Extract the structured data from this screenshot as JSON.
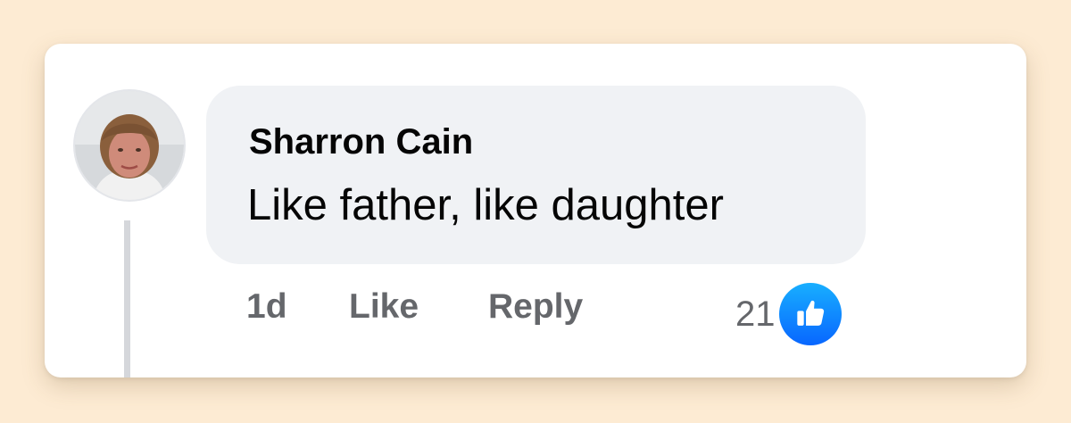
{
  "comment": {
    "author": "Sharron Cain",
    "text": "Like father, like daughter",
    "timestamp": "1d",
    "like_label": "Like",
    "reply_label": "Reply",
    "reaction_count": "21",
    "reaction_type": "thumbs-up-icon"
  },
  "colors": {
    "page_background": "#fdebd3",
    "card_background": "#ffffff",
    "bubble_background": "#f0f2f5",
    "text_primary": "#050505",
    "text_secondary": "#65676b",
    "reaction_blue": "#0866ff"
  }
}
